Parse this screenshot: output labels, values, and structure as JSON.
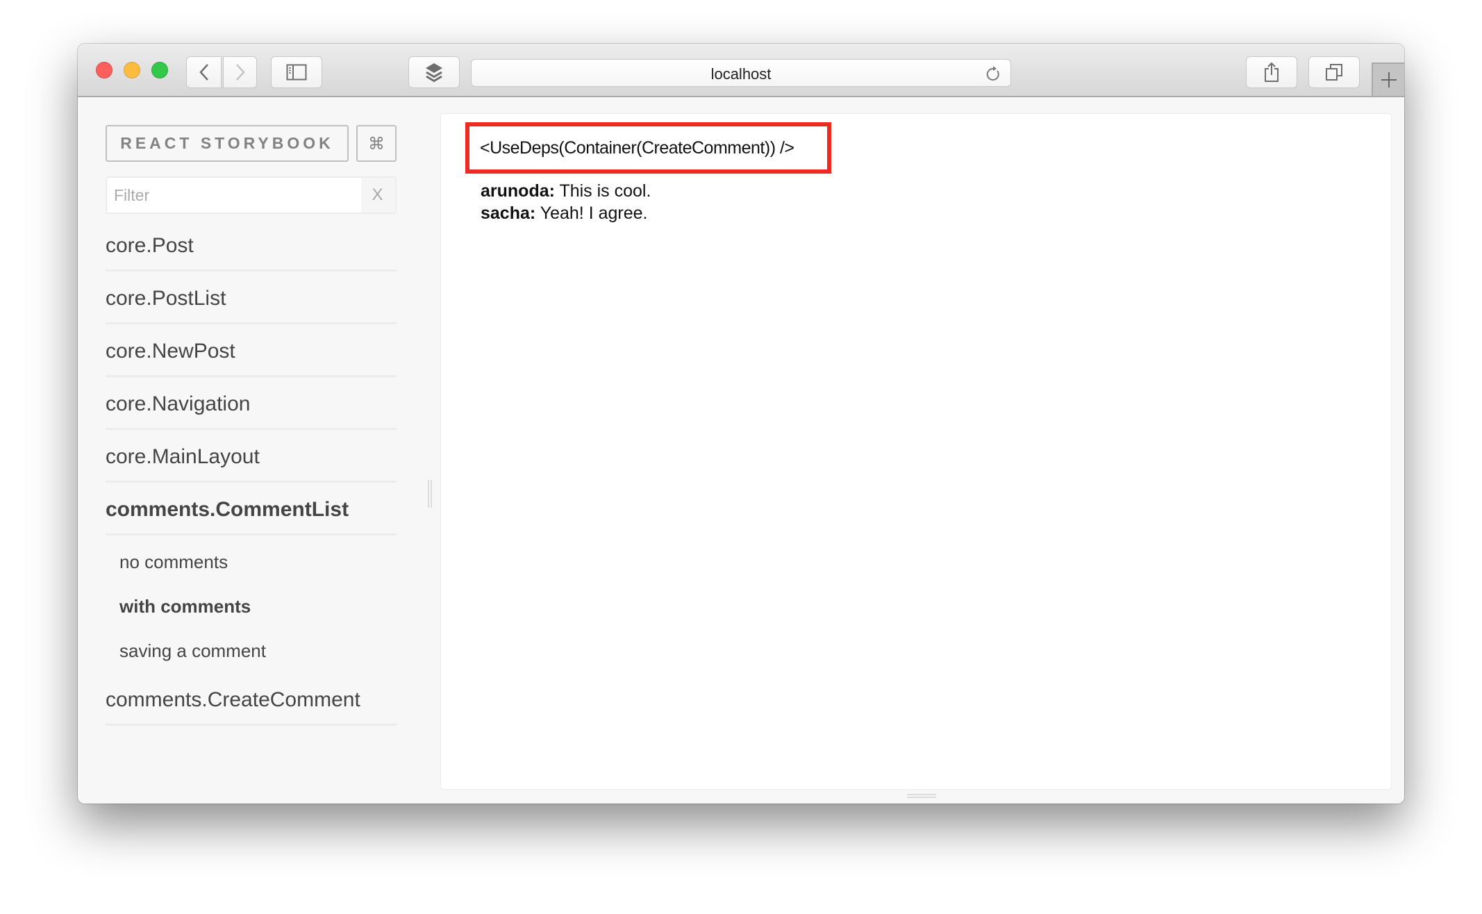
{
  "browser": {
    "address_url": "localhost",
    "buttons": {
      "back": "back-icon",
      "forward": "forward-icon",
      "sidebar": "sidebar-icon",
      "extensions": "layers-icon",
      "reload": "reload-icon",
      "share": "share-icon",
      "tabs": "tabs-icon",
      "new_tab": "plus-icon"
    }
  },
  "sidebar": {
    "header_label": "REACT STORYBOOK",
    "shortcut_label": "⌘",
    "filter": {
      "placeholder": "Filter",
      "value": "",
      "clear_label": "X"
    },
    "kinds": [
      {
        "label": "core.Post",
        "selected": false
      },
      {
        "label": "core.PostList",
        "selected": false
      },
      {
        "label": "core.NewPost",
        "selected": false
      },
      {
        "label": "core.Navigation",
        "selected": false
      },
      {
        "label": "core.MainLayout",
        "selected": false
      },
      {
        "label": "comments.CommentList",
        "selected": true,
        "stories": [
          {
            "label": "no comments",
            "selected": false
          },
          {
            "label": "with comments",
            "selected": true
          },
          {
            "label": "saving a comment",
            "selected": false
          }
        ]
      },
      {
        "label": "comments.CreateComment",
        "selected": false
      }
    ]
  },
  "preview": {
    "component_label": "<UseDeps(Container(CreateComment)) />",
    "highlight_color": "#ee2b22",
    "comments": [
      {
        "author": "arunoda:",
        "text": " This is cool."
      },
      {
        "author": "sacha:",
        "text": " Yeah! I agree."
      }
    ]
  }
}
